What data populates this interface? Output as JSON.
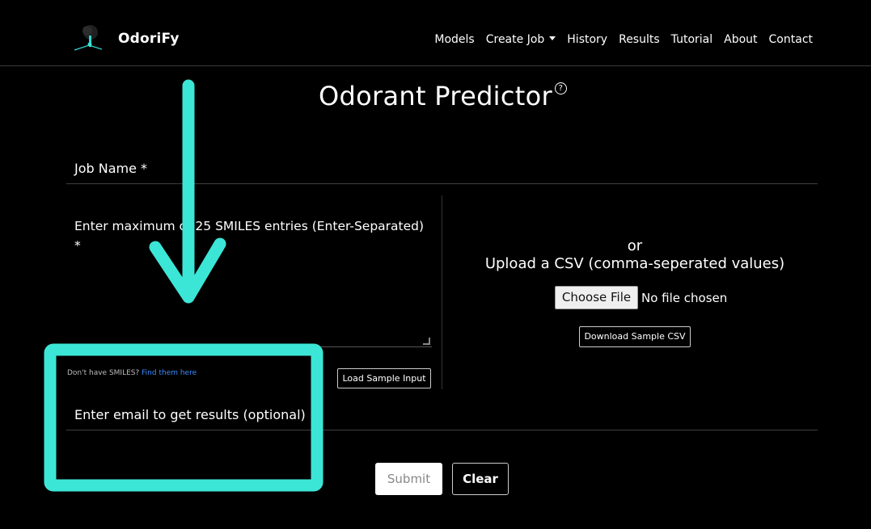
{
  "brand": {
    "name": "OdoriFy",
    "logo_icon": "tree-logo-icon"
  },
  "nav": {
    "items": [
      {
        "label": "Models"
      },
      {
        "label": "Create Job",
        "has_dropdown": true
      },
      {
        "label": "History"
      },
      {
        "label": "Results"
      },
      {
        "label": "Tutorial"
      },
      {
        "label": "About"
      },
      {
        "label": "Contact"
      }
    ]
  },
  "page": {
    "title": "Odorant Predictor",
    "help_icon_text": "?"
  },
  "form": {
    "job_name_label": "Job Name *",
    "smiles_label": "Enter maximum of 25 SMILES entries (Enter-Separated) *",
    "dont_have_text": "Don't have SMILES?",
    "find_link": "Find them here",
    "load_sample_button": "Load Sample Input",
    "or_text": "or",
    "upload_text": "Upload a CSV (comma-seperated values)",
    "choose_file_button": "Choose File",
    "no_file_text": "No file chosen",
    "download_sample_button": "Download Sample CSV",
    "email_label": "Enter email to get results (optional)",
    "submit_button": "Submit",
    "clear_button": "Clear"
  },
  "colors": {
    "background": "#000000",
    "annotation": "#3ce6d6",
    "link": "#3d8bfd"
  }
}
